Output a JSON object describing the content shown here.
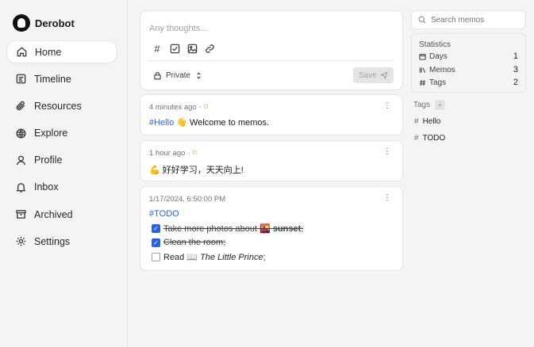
{
  "app": {
    "name": "Derobot"
  },
  "nav": [
    {
      "label": "Home",
      "icon": "home-icon",
      "active": true
    },
    {
      "label": "Timeline",
      "icon": "timeline-icon"
    },
    {
      "label": "Resources",
      "icon": "paperclip-icon"
    },
    {
      "label": "Explore",
      "icon": "globe-icon"
    },
    {
      "label": "Profile",
      "icon": "user-icon"
    },
    {
      "label": "Inbox",
      "icon": "bell-icon"
    },
    {
      "label": "Archived",
      "icon": "archive-icon"
    },
    {
      "label": "Settings",
      "icon": "gear-icon"
    }
  ],
  "editor": {
    "placeholder": "Any thoughts...",
    "visibility": "Private",
    "save_label": "Save"
  },
  "memos": [
    {
      "time": "4 minutes ago",
      "tag": "#Hello",
      "emoji": "👋",
      "text": "Welcome to memos."
    },
    {
      "time": "1 hour ago",
      "emoji": "💪",
      "text": "好好学习，天天向上!"
    },
    {
      "time": "1/17/2024, 6:50:00 PM",
      "tag": "#TODO",
      "tasks": [
        {
          "done": true,
          "text": "Take more photos about ",
          "emoji": "🌇",
          "bold": "sunset",
          "suffix": ";"
        },
        {
          "done": true,
          "text": "Clean the room;"
        },
        {
          "done": false,
          "text": "Read ",
          "emoji": "📖",
          "italic": "The Little Prince",
          "suffix": ";"
        }
      ]
    }
  ],
  "search": {
    "placeholder": "Search memos"
  },
  "stats": {
    "title": "Statistics",
    "rows": [
      {
        "label": "Days",
        "value": "1",
        "icon": "calendar-icon"
      },
      {
        "label": "Memos",
        "value": "3",
        "icon": "library-icon"
      },
      {
        "label": "Tags",
        "value": "2",
        "icon": "hash-icon"
      }
    ]
  },
  "tags": {
    "title": "Tags",
    "items": [
      "Hello",
      "TODO"
    ]
  },
  "colors": {
    "accent": "#2563eb",
    "bookmark": "#f59e0b"
  }
}
